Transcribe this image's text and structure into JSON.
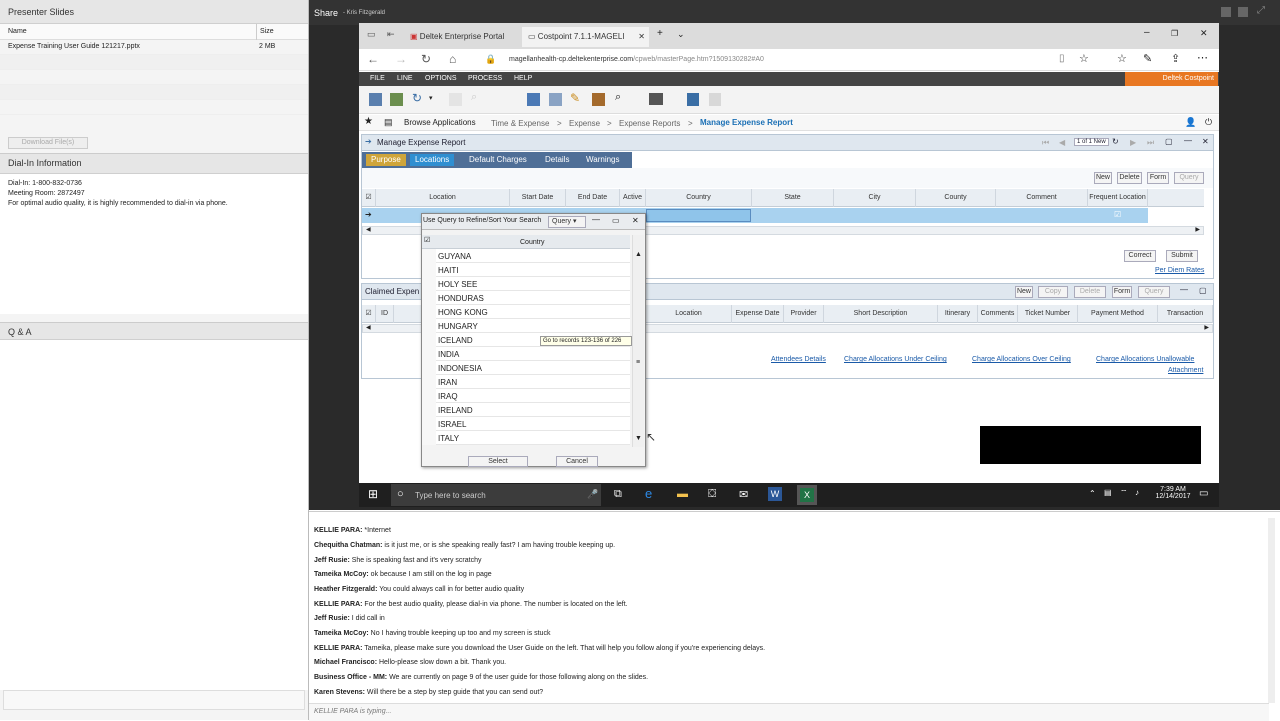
{
  "left_panel": {
    "presenter_slides_title": "Presenter Slides",
    "col_name": "Name",
    "col_size": "Size",
    "files": [
      {
        "name": "Expense Training User Guide 121217.pptx",
        "size": "2 MB"
      }
    ],
    "download_button": "Download File(s)",
    "dialin_title": "Dial-In Information",
    "dialin_line1": "Dial-In: 1-800-832-0736",
    "dialin_line2": "Meeting Room: 2872497",
    "dialin_line3": "For optimal audio quality, it is highly recommended to dial-in via phone.",
    "qa_title": "Q & A"
  },
  "share": {
    "title": "Share",
    "presenter": "- Kris Fitzgerald"
  },
  "browser": {
    "tab1": "Deltek Enterprise Portal",
    "tab2": "Costpoint 7.1.1-MAGELI",
    "url_host": "magellanhealth-cp.deltekenterprise.com",
    "url_path": "/cpweb/masterPage.htm?1509130282#A0"
  },
  "app": {
    "menu": [
      "FILE",
      "LINE",
      "OPTIONS",
      "PROCESS",
      "HELP"
    ],
    "brand": "Deltek Costpoint",
    "breadcrumb": {
      "browse": "Browse Applications",
      "c1": "Time & Expense",
      "c2": "Expense",
      "c3": "Expense Reports",
      "current": "Manage Expense Report"
    },
    "window_title": "Manage Expense Report",
    "record_nav": "1 of 1 New",
    "subtabs": [
      "Purpose",
      "Locations",
      "Default Charges",
      "Details",
      "Warnings"
    ],
    "grid_buttons": [
      "New",
      "Delete",
      "Form",
      "Query"
    ],
    "columns": [
      "Location",
      "Start Date",
      "End Date",
      "Active",
      "Country",
      "State",
      "City",
      "County",
      "Comment",
      "Frequent Location"
    ],
    "correct_button": "Correct",
    "submit_button": "Submit",
    "per_diem_link": "Per Diem Rates",
    "claimed_title": "Claimed Expen",
    "claimed_buttons": [
      "New",
      "Copy",
      "Delete",
      "Form",
      "Query"
    ],
    "claimed_columns": [
      "ID",
      "Location",
      "Expense Date",
      "Provider",
      "Short Description",
      "Itinerary",
      "Comments",
      "Ticket Number",
      "Payment Method",
      "Transaction"
    ],
    "links": [
      "Attendees Details",
      "Charge Allocations Under Ceiling",
      "Charge Allocations Over Ceiling",
      "Charge Allocations Unallowable",
      "Attachment"
    ]
  },
  "popup": {
    "title": "Use Query to Refine/Sort Your Search",
    "query_label": "Query",
    "column_header": "Country",
    "countries": [
      "GUYANA",
      "HAITI",
      "HOLY SEE",
      "HONDURAS",
      "HONG KONG",
      "HUNGARY",
      "ICELAND",
      "INDIA",
      "INDONESIA",
      "IRAN",
      "IRAQ",
      "IRELAND",
      "ISRAEL",
      "ITALY"
    ],
    "records_tooltip": "Go to records 123-136 of 226",
    "select_button": "Select",
    "cancel_button": "Cancel"
  },
  "taskbar": {
    "search_placeholder": "Type here to search",
    "time": "7:39 AM",
    "date": "12/14/2017"
  },
  "chat": {
    "messages": [
      {
        "user": "KELLIE PARA:",
        "text": " *Internet"
      },
      {
        "user": "Chequitha  Chatman:",
        "text": " is it just me, or is she speaking really fast?  I am having trouble keeping up."
      },
      {
        "user": "Jeff Rusie:",
        "text": " She is speaking fast and it's very scratchy"
      },
      {
        "user": "Tameika McCoy:",
        "text": " ok because I am still on the log in page"
      },
      {
        "user": "Heather Fitzgerald:",
        "text": " You could always call in for better audio quality"
      },
      {
        "user": "KELLIE PARA:",
        "text": " For the best audio quality, please dial-in via phone. The number is located on the left."
      },
      {
        "user": "Jeff Rusie:",
        "text": " I did call in"
      },
      {
        "user": "Tameika McCoy:",
        "text": " No I having trouble keeping  up too  and my screen is stuck"
      },
      {
        "user": "KELLIE PARA:",
        "text": " Tameika, please make sure you download the User Guide on the left. That will help you follow along if you're experiencing delays."
      },
      {
        "user": "Michael Francisco:",
        "text": " Hello-please slow down a bit.  Thank you."
      },
      {
        "user": "Business Office - MM:",
        "text": " We are currently on page 9 of the user guide for those following along on the slides."
      },
      {
        "user": "Karen Stevens:",
        "text": " Will there be a step by step guide that you can send out?"
      }
    ],
    "typing": "KELLIE PARA is typing..."
  }
}
